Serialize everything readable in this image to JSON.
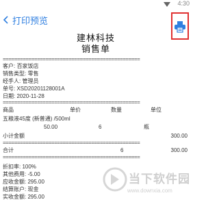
{
  "status": {
    "time": "4:30"
  },
  "appbar": {
    "back_label": "打印预览"
  },
  "receipt": {
    "title": "建林科技",
    "subtitle": "销售单",
    "separator": "================================================",
    "customer": "客户: 百家饭店",
    "sale_type": "销售类型: 零售",
    "handler": "经手人: 管理员",
    "order_no": "单号: XSD20201128001A",
    "date": "日期: 2020-11-28",
    "headers": [
      "商品",
      "单价",
      "数量",
      "单位"
    ],
    "item": {
      "name": "五粮液45度 (新普通) /500ml",
      "price": "50.00",
      "qty": "6",
      "unit": "瓶"
    },
    "subtotal": {
      "label": "小计金额",
      "value": "300.00"
    },
    "total": {
      "label": "合计",
      "qty": "6",
      "value": "300.00"
    },
    "discount": "折扣率: 100%",
    "other_fee": "其他费用: -5.00",
    "receivable": "应收金额: 295.00",
    "account": "结算账户: 现金",
    "received": "实收金额: 295.00"
  },
  "watermark": {
    "text": "当下软件园",
    "url": "www.downxia.com"
  },
  "colors": {
    "accent": "#2f7fe0",
    "highlight": "#e03030"
  }
}
